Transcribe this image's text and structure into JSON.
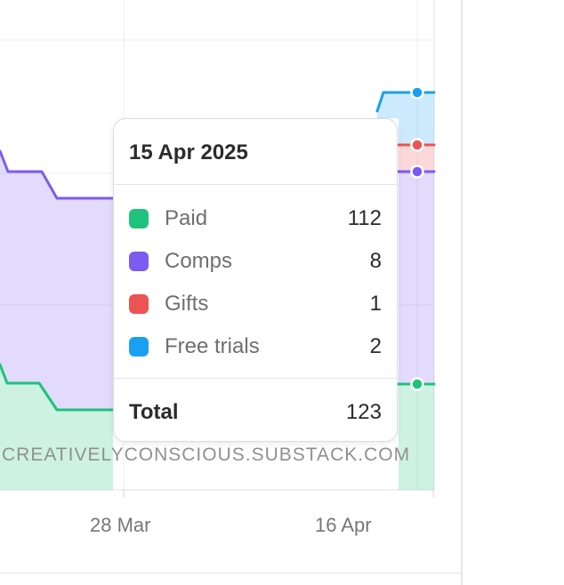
{
  "chart_data": {
    "type": "area",
    "stacked": true,
    "series": [
      {
        "name": "Paid",
        "color": "#1fc27a"
      },
      {
        "name": "Comps",
        "color": "#7b5cf0"
      },
      {
        "name": "Gifts",
        "color": "#ec5353"
      },
      {
        "name": "Free trials",
        "color": "#1aa0f0"
      }
    ],
    "x_ticks": [
      "28 Mar",
      "16 Apr"
    ],
    "watermark": "CREATIVELYCONSCIOUS.SUBSTACK.COM",
    "tooltip": {
      "date": "15 Apr 2025",
      "rows": [
        {
          "label": "Paid",
          "value": "112",
          "color": "#1fc27a"
        },
        {
          "label": "Comps",
          "value": "8",
          "color": "#7b5cf0"
        },
        {
          "label": "Gifts",
          "value": "1",
          "color": "#ec5353"
        },
        {
          "label": "Free trials",
          "value": "2",
          "color": "#1aa0f0"
        }
      ],
      "total_label": "Total",
      "total_value": "123"
    }
  }
}
